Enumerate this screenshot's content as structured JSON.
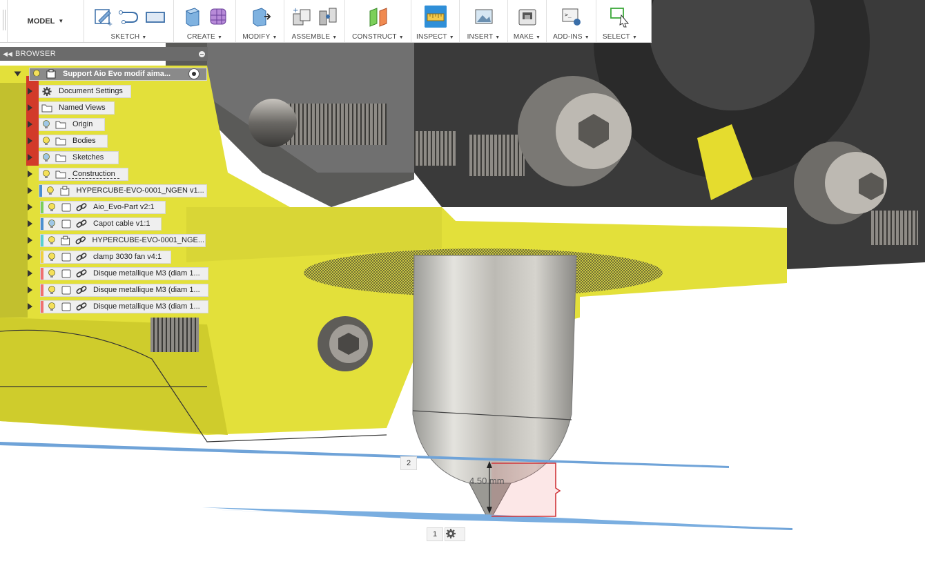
{
  "toolbar": {
    "workspace": "MODEL",
    "groups": [
      {
        "label": "SKETCH"
      },
      {
        "label": "CREATE"
      },
      {
        "label": "MODIFY"
      },
      {
        "label": "ASSEMBLE"
      },
      {
        "label": "CONSTRUCT"
      },
      {
        "label": "INSPECT"
      },
      {
        "label": "INSERT"
      },
      {
        "label": "MAKE"
      },
      {
        "label": "ADD-INS"
      },
      {
        "label": "SELECT"
      }
    ],
    "accent_color": "#2f8fd8"
  },
  "browser": {
    "title": "BROWSER",
    "root": "Support Aio Evo modif aima...",
    "items": [
      {
        "label": "Document Settings",
        "icon": "gear-icon"
      },
      {
        "label": "Named Views",
        "icon": "folder-icon"
      },
      {
        "label": "Origin",
        "icon": "folder-icon"
      },
      {
        "label": "Bodies",
        "icon": "folder-icon"
      },
      {
        "label": "Sketches",
        "icon": "folder-icon"
      },
      {
        "label": "Construction",
        "icon": "folder-icon"
      },
      {
        "label": "HYPERCUBE-EVO-0001_NGEN v1...",
        "icon": "component-icon",
        "color": "#4a8fd0"
      },
      {
        "label": "Aio_Evo-Part v2:1",
        "icon": "link-icon",
        "color": "#7ccf5a"
      },
      {
        "label": "Capot cable v1:1",
        "icon": "link-icon",
        "color": "#4a8fd0"
      },
      {
        "label": "HYPERCUBE-EVO-0001_NGE...",
        "icon": "link-icon",
        "color": "#5ad0cf"
      },
      {
        "label": "clamp 3030 fan v4:1",
        "icon": "link-icon",
        "color": "#f0d040"
      },
      {
        "label": "Disque metallique M3 (diam 1...",
        "icon": "link-icon",
        "color": "#f07070"
      },
      {
        "label": "Disque metallique M3 (diam 1...",
        "icon": "link-icon",
        "color": "#f07070"
      },
      {
        "label": "Disque metallique M3 (diam 1...",
        "icon": "link-icon",
        "color": "#f07070"
      }
    ]
  },
  "viewport": {
    "dimension_text": "4.50 mm",
    "plane_marker_upper": "2",
    "plane_marker_lower": "1",
    "model_color": "#e3e03a",
    "plane_color": "#6fa3d8"
  }
}
